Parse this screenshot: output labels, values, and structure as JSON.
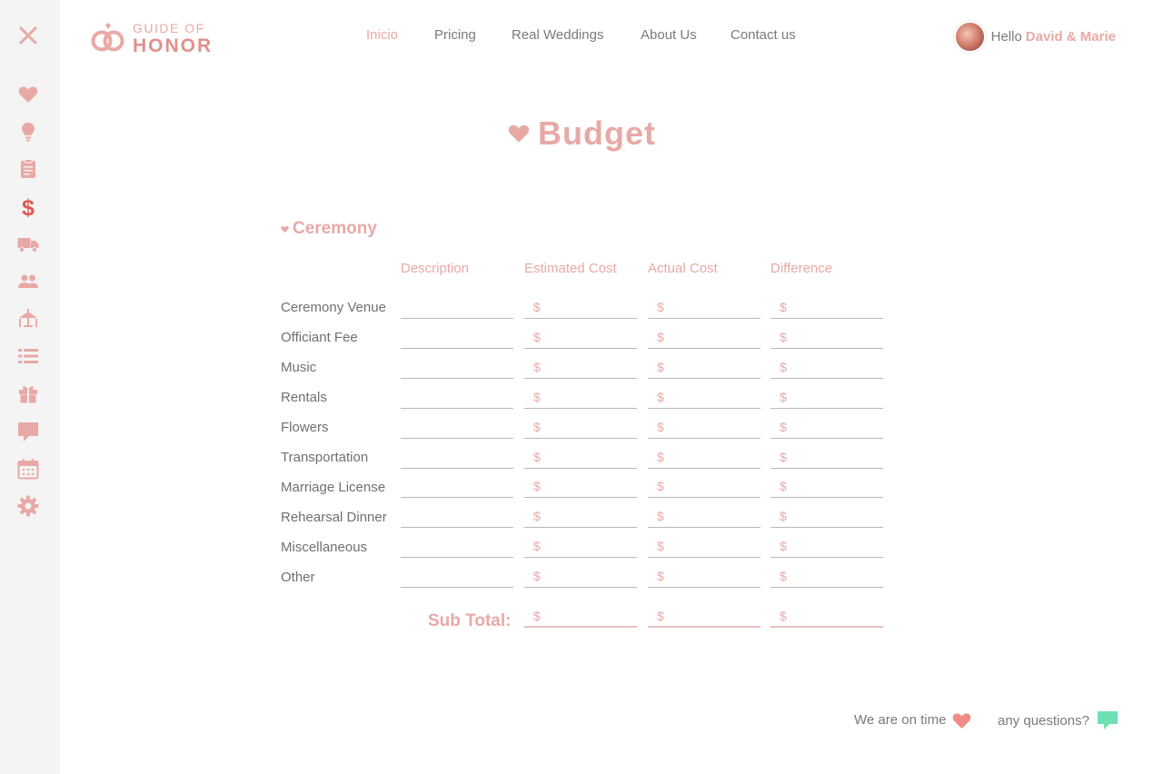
{
  "sidebar": {
    "close_icon": "close-icon",
    "items": [
      {
        "icon": "heart-icon"
      },
      {
        "icon": "lightbulb-icon"
      },
      {
        "icon": "clipboard-icon"
      },
      {
        "icon": "dollar-icon",
        "active": true
      },
      {
        "icon": "truck-icon"
      },
      {
        "icon": "guests-icon"
      },
      {
        "icon": "table-seating-icon"
      },
      {
        "icon": "list-icon"
      },
      {
        "icon": "gift-icon"
      },
      {
        "icon": "chat-icon"
      },
      {
        "icon": "calendar-icon"
      },
      {
        "icon": "gear-icon"
      }
    ]
  },
  "logo": {
    "line1": "GUIDE OF",
    "line2": "HONOR"
  },
  "nav": {
    "inicio": "Inicio",
    "pricing": "Pricing",
    "real_weddings": "Real Weddings",
    "about": "About Us",
    "contact": "Contact us"
  },
  "user": {
    "greeting": "Hello",
    "name": "David & Marie"
  },
  "page": {
    "title": "Budget"
  },
  "section": {
    "title": "Ceremony"
  },
  "columns": {
    "description": "Description",
    "estimated": "Estimated Cost",
    "actual": "Actual Cost",
    "difference": "Difference"
  },
  "currency": "$",
  "rows": [
    {
      "label": "Ceremony Venue"
    },
    {
      "label": "Officiant Fee"
    },
    {
      "label": "Music"
    },
    {
      "label": "Rentals"
    },
    {
      "label": "Flowers"
    },
    {
      "label": "Transportation"
    },
    {
      "label": "Marriage License"
    },
    {
      "label": "Rehearsal Dinner"
    },
    {
      "label": "Miscellaneous"
    },
    {
      "label": "Other"
    }
  ],
  "subtotal": {
    "label": "Sub Total:"
  },
  "footer": {
    "on_time": "We are on time",
    "questions": "any questions?"
  },
  "colors": {
    "accent": "#e8a9a6",
    "accent_strong": "#e05a55",
    "mint": "#6ee0b4",
    "sidebar_bg": "#f4f4f4"
  }
}
